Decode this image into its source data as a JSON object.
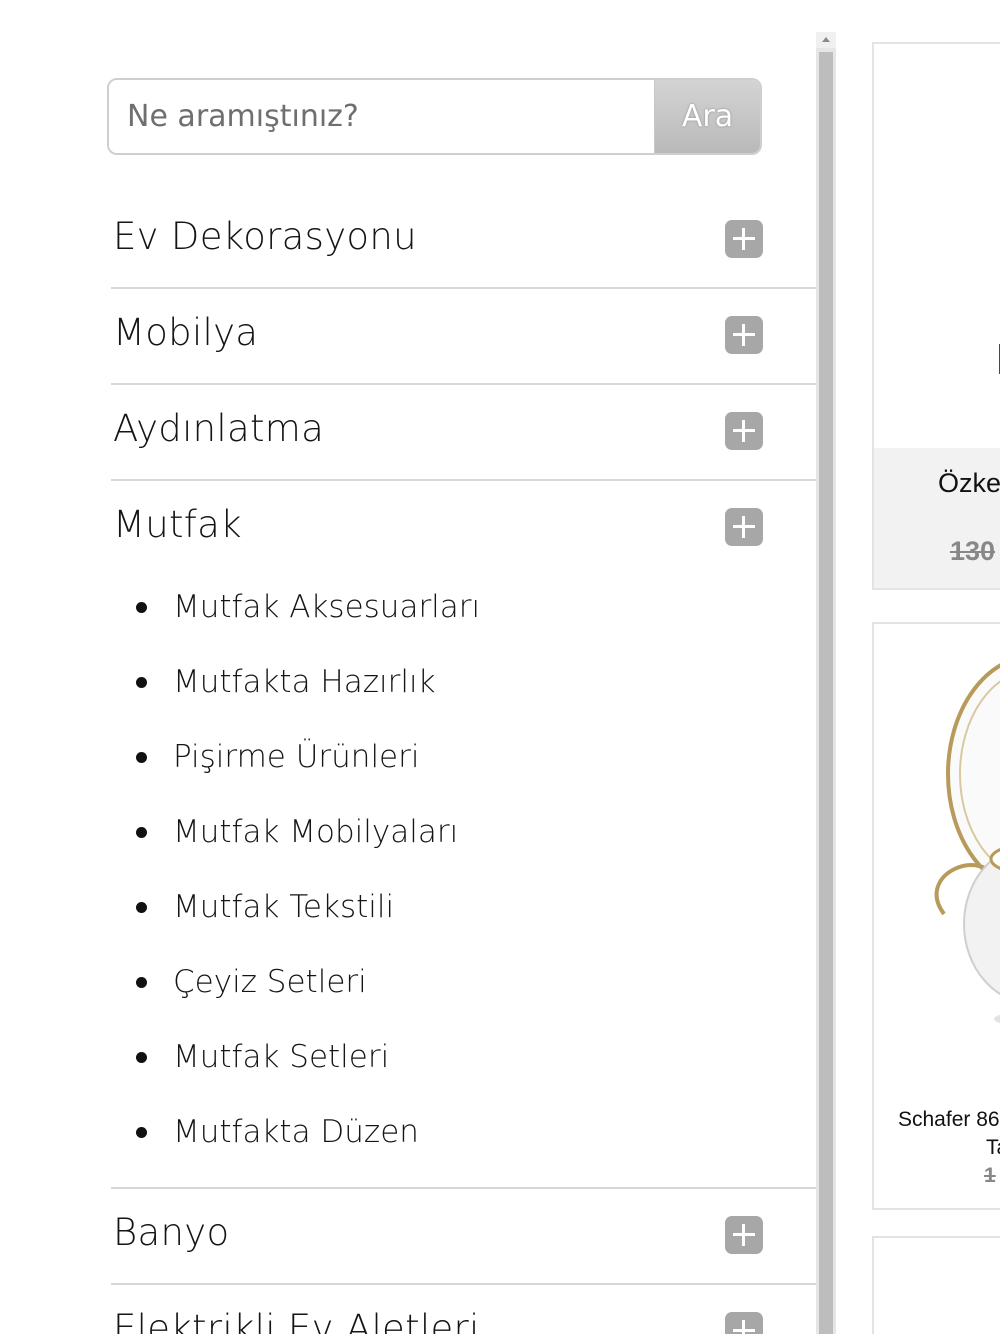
{
  "search": {
    "placeholder": "Ne aramıştınız?",
    "button_label": "Ara"
  },
  "menu": {
    "categories": [
      {
        "label": "Ev Dekorasyonu"
      },
      {
        "label": "Mobilya"
      },
      {
        "label": "Aydınlatma"
      },
      {
        "label": "Mutfak",
        "subitems": [
          "Mutfak Aksesuarları",
          "Mutfakta Hazırlık",
          "Pişirme Ürünleri",
          "Mutfak Mobilyaları",
          "Mutfak Tekstili",
          "Çeyiz Setleri",
          "Mutfak Setleri",
          "Mutfakta Düzen"
        ]
      },
      {
        "label": "Banyo"
      },
      {
        "label": "Elektrikli Ev Aletleri"
      }
    ]
  },
  "products": [
    {
      "title": "Özke",
      "old_price": "130"
    },
    {
      "title": "Schafer 86",
      "title_line2": "Ta",
      "old_price": "1"
    }
  ]
}
